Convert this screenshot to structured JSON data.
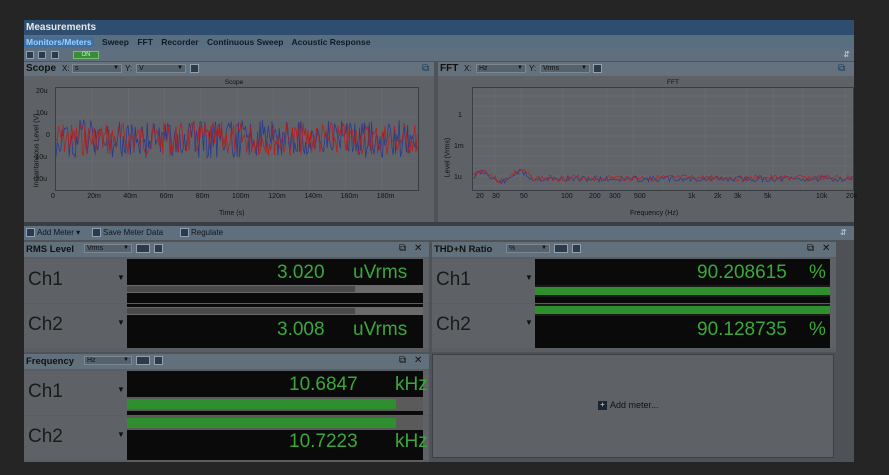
{
  "window": {
    "title": "Measurements"
  },
  "menu": {
    "items": [
      "Monitors/Meters",
      "Sweep",
      "FFT",
      "Recorder",
      "Continuous Sweep",
      "Acoustic Response"
    ],
    "active": "Monitors/Meters"
  },
  "toolbar": {
    "on_label": "ON"
  },
  "scope": {
    "name": "Scope",
    "x_label": "X:",
    "x_unit": "s",
    "y_label": "Y:",
    "y_unit": "V",
    "plot_title": "Scope",
    "y_axis_title": "Instantaneous Level (V)",
    "x_axis_title": "Time (s)",
    "y_ticks": [
      "20u",
      "10u",
      "0",
      "-10u",
      "-20u"
    ],
    "x_ticks": [
      "0",
      "20m",
      "40m",
      "60m",
      "80m",
      "100m",
      "120m",
      "140m",
      "160m",
      "180m"
    ]
  },
  "fft": {
    "name": "FFT",
    "x_label": "X:",
    "x_unit": "Hz",
    "y_label": "Y:",
    "y_unit": "Vrms",
    "plot_title": "FFT",
    "y_axis_title": "Level (Vrms)",
    "x_axis_title": "Frequency (Hz)",
    "y_ticks": [
      "1",
      "1m",
      "1u"
    ],
    "x_ticks": [
      "20",
      "30",
      "50",
      "100",
      "200",
      "300",
      "500",
      "1k",
      "2k",
      "3k",
      "5k",
      "10k",
      "20k"
    ]
  },
  "meter_toolbar": {
    "add_meter": "Add Meter",
    "save_meter_data": "Save Meter Data",
    "regulate": "Regulate"
  },
  "rms": {
    "name": "RMS Level",
    "unit_select": "Vrms",
    "ch1": {
      "label": "Ch1",
      "value": "3.020",
      "unit": "uVrms",
      "bar": 0.77
    },
    "ch2": {
      "label": "Ch2",
      "value": "3.008",
      "unit": "uVrms",
      "bar": 0.77
    }
  },
  "thdn": {
    "name": "THD+N Ratio",
    "unit_select": "%",
    "ch1": {
      "label": "Ch1",
      "value": "90.208615",
      "unit": "%",
      "bar": 1.0
    },
    "ch2": {
      "label": "Ch2",
      "value": "90.128735",
      "unit": "%",
      "bar": 1.0
    }
  },
  "freq": {
    "name": "Frequency",
    "unit_select": "Hz",
    "ch1": {
      "label": "Ch1",
      "value": "10.6847",
      "unit": "kHz",
      "bar": 0.91
    },
    "ch2": {
      "label": "Ch2",
      "value": "10.7223",
      "unit": "kHz",
      "bar": 0.91
    }
  },
  "add_meter_panel": {
    "label": "Add meter..."
  },
  "colors": {
    "trace_red": "#b22020",
    "trace_blue": "#2a3a8a",
    "lcd_green": "#3aa83a",
    "bar_green": "#2f8f2f"
  }
}
